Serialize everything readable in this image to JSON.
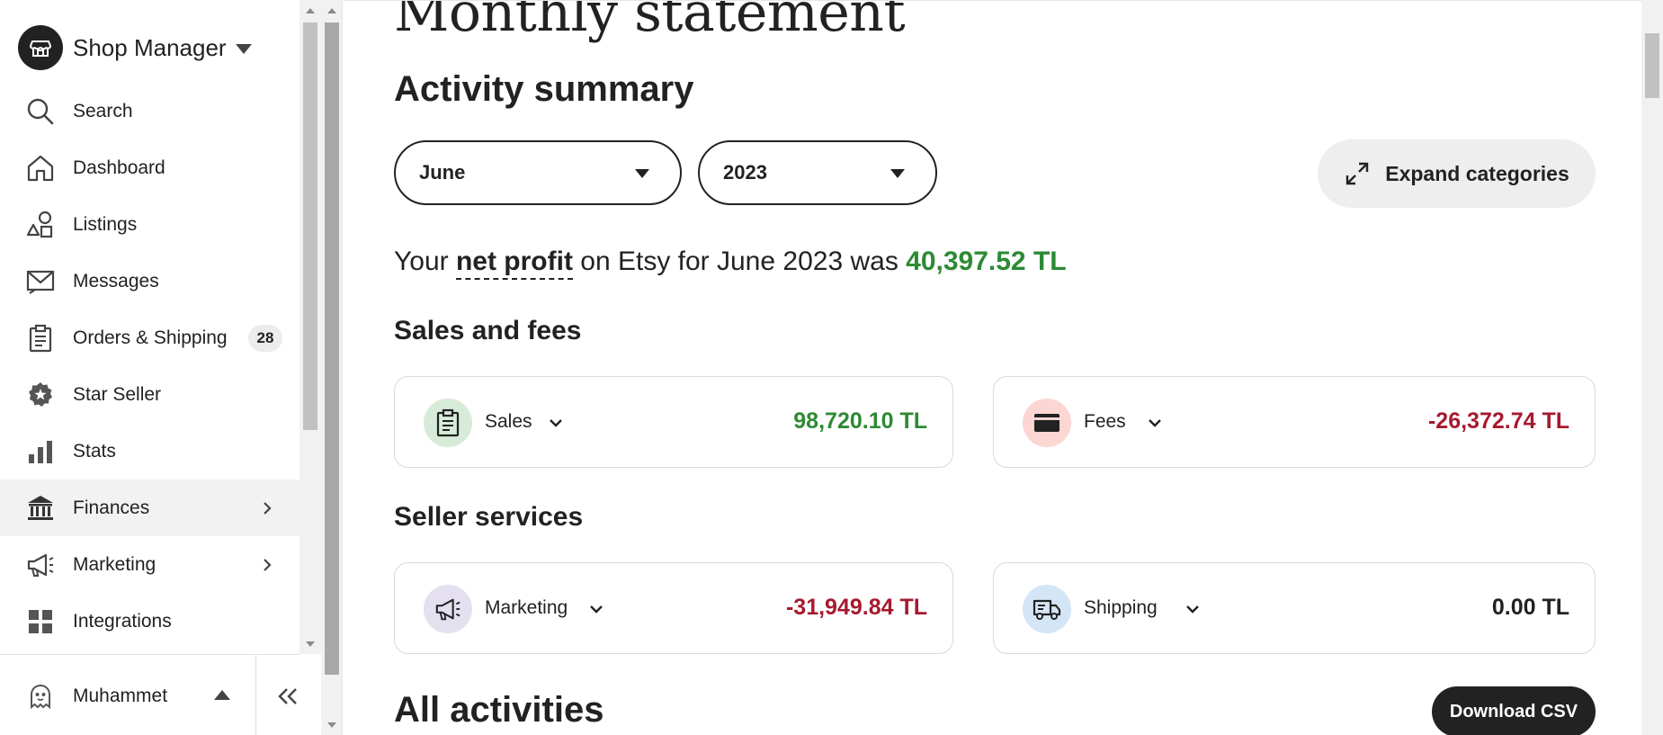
{
  "sidebar": {
    "brand": {
      "title": "Shop Manager"
    },
    "items": [
      {
        "label": "Search",
        "icon": "search-icon"
      },
      {
        "label": "Dashboard",
        "icon": "home-icon"
      },
      {
        "label": "Listings",
        "icon": "shapes-icon"
      },
      {
        "label": "Messages",
        "icon": "envelope-icon"
      },
      {
        "label": "Orders & Shipping",
        "icon": "clipboard-icon",
        "badge": "28"
      },
      {
        "label": "Star Seller",
        "icon": "star-badge-icon"
      },
      {
        "label": "Stats",
        "icon": "bar-chart-icon"
      },
      {
        "label": "Finances",
        "icon": "bank-icon",
        "active": true
      },
      {
        "label": "Marketing",
        "icon": "megaphone-icon"
      },
      {
        "label": "Integrations",
        "icon": "grid-icon"
      }
    ],
    "footer": {
      "user_name": "Muhammet"
    }
  },
  "main": {
    "page_title": "Monthly statement",
    "section_title": "Activity summary",
    "month_select": {
      "value": "June"
    },
    "year_select": {
      "value": "2023"
    },
    "expand_button": {
      "label": "Expand categories"
    },
    "net_profit": {
      "prefix": "Your ",
      "term": "net profit",
      "middle": " on Etsy for June 2023 was ",
      "amount": "40,397.52 TL"
    },
    "groups": [
      {
        "title": "Sales and fees",
        "cards": [
          {
            "label": "Sales",
            "value": "98,720.10 TL",
            "icon": "clipboard-icon"
          },
          {
            "label": "Fees",
            "value": "-26,372.74 TL",
            "icon": "card-icon"
          }
        ]
      },
      {
        "title": "Seller services",
        "cards": [
          {
            "label": "Marketing",
            "value": "-31,949.84 TL",
            "icon": "megaphone-icon"
          },
          {
            "label": "Shipping",
            "value": "0.00 TL",
            "icon": "truck-icon"
          }
        ]
      }
    ],
    "all_activities": {
      "title": "All activities",
      "download_label": "Download CSV"
    }
  },
  "colors": {
    "positive": "#2d8a34",
    "negative": "#a61a2e",
    "neutral": "#222222",
    "sales_icon_bg": "#d6ecd9",
    "fees_icon_bg": "#fbd6d2",
    "marketing_icon_bg": "#e4e0f0",
    "shipping_icon_bg": "#d4e6f6"
  }
}
